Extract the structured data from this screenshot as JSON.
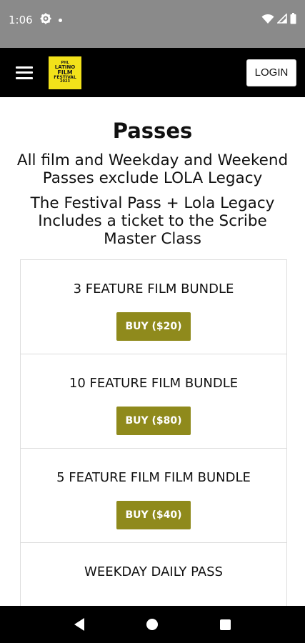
{
  "status_bar": {
    "time": "1:06",
    "icons": [
      "gear-icon",
      "notification-dot-icon",
      "wifi-icon",
      "cellular-icon",
      "battery-icon"
    ]
  },
  "app_bar": {
    "logo_lines": [
      "PHL",
      "LATINO",
      "FILM",
      "FESTIVAL",
      "2023"
    ],
    "login_label": "LOGIN",
    "menu_icon": "hamburger-menu-icon"
  },
  "page": {
    "title": "Passes",
    "subtitle_1": "All film and Weekday and Weekend Passes exclude LOLA Legacy",
    "subtitle_2": "The Festival Pass + Lola Legacy Includes a ticket to the Scribe Master Class"
  },
  "passes": [
    {
      "name": "3 FEATURE FILM BUNDLE",
      "button": "BUY ($20)"
    },
    {
      "name": "10 FEATURE FILM BUNDLE",
      "button": "BUY ($80)"
    },
    {
      "name": "5 FEATURE FILM FILM BUNDLE",
      "button": "BUY ($40)"
    },
    {
      "name": "WEEKDAY DAILY PASS",
      "button": ""
    }
  ],
  "colors": {
    "status_bar": "#8a8a8a",
    "app_bar": "#000000",
    "buy_button": "#8f8a1c",
    "logo_bg": "#f2e21a"
  },
  "nav_bar": {
    "icons": [
      "back-icon",
      "home-icon",
      "recents-icon"
    ]
  }
}
